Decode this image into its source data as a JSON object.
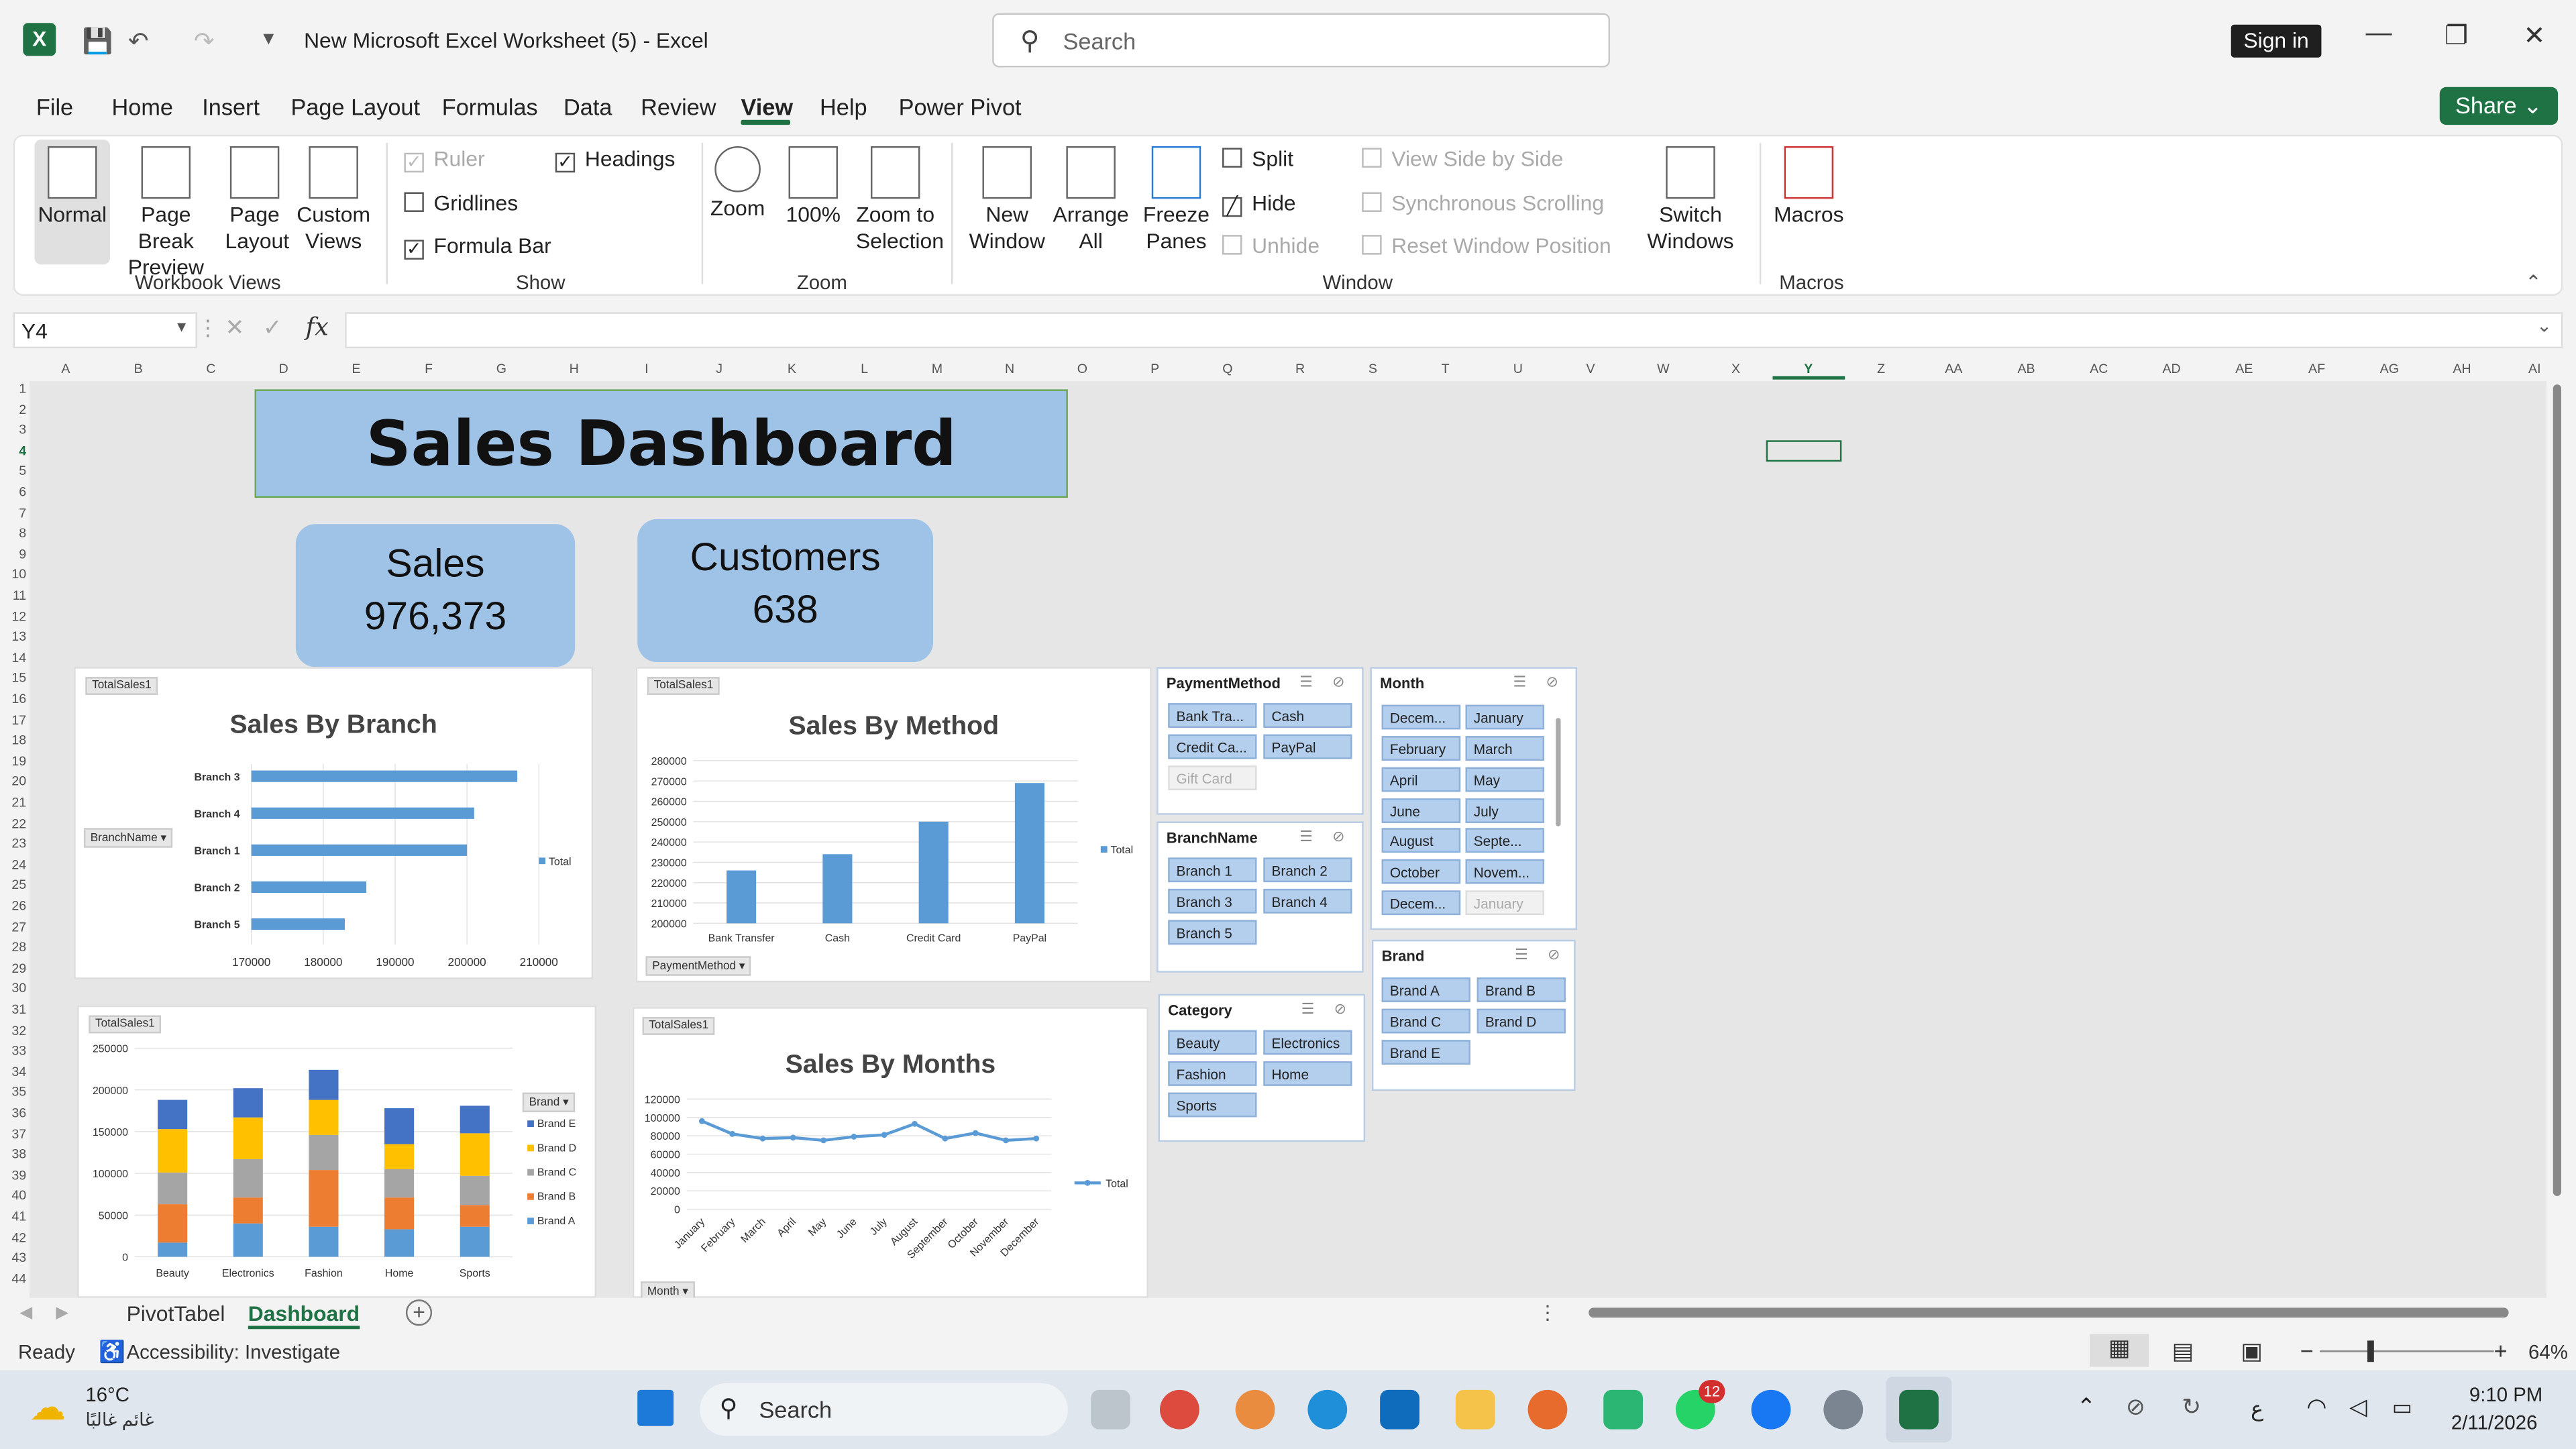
{
  "window": {
    "doc_title": "New Microsoft Excel Worksheet (5)  -  Excel",
    "search_placeholder": "Search",
    "sign_in": "Sign in",
    "share": "Share"
  },
  "tabs": [
    "File",
    "Home",
    "Insert",
    "Page Layout",
    "Formulas",
    "Data",
    "Review",
    "View",
    "Help",
    "Power Pivot"
  ],
  "ribbon": {
    "workbook_views": {
      "normal": "Normal",
      "page_break": "Page Break Preview",
      "page_layout": "Page Layout",
      "custom_views": "Custom Views",
      "group": "Workbook Views"
    },
    "show": {
      "ruler": "Ruler",
      "gridlines": "Gridlines",
      "formula_bar": "Formula Bar",
      "headings": "Headings",
      "group": "Show"
    },
    "zoom": {
      "zoom": "Zoom",
      "hundred": "100%",
      "zoom_sel": "Zoom to Selection",
      "group": "Zoom"
    },
    "window": {
      "new_window": "New Window",
      "arrange_all": "Arrange All",
      "freeze": "Freeze Panes",
      "split": "Split",
      "hide": "Hide",
      "unhide": "Unhide",
      "side_by_side": "View Side by Side",
      "sync_scroll": "Synchronous Scrolling",
      "reset_pos": "Reset Window Position",
      "switch": "Switch Windows",
      "group": "Window"
    },
    "macros": {
      "macros": "Macros",
      "group": "Macros"
    }
  },
  "formula": {
    "name_box": "Y4",
    "fx": "fx",
    "content": ""
  },
  "columns": [
    "A",
    "B",
    "C",
    "D",
    "E",
    "F",
    "G",
    "H",
    "I",
    "J",
    "K",
    "L",
    "M",
    "N",
    "O",
    "P",
    "Q",
    "R",
    "S",
    "T",
    "U",
    "V",
    "W",
    "X",
    "Y",
    "Z",
    "AA",
    "AB",
    "AC",
    "AD",
    "AE",
    "AF",
    "AG",
    "AH",
    "AI"
  ],
  "dashboard": {
    "title": "Sales Dashboard",
    "sales_label": "Sales",
    "sales_value": "976,373",
    "customers_label": "Customers",
    "customers_value": "638"
  },
  "chart_data": [
    {
      "type": "bar",
      "orientation": "horizontal",
      "title": "Sales By Branch",
      "field_button": "TotalSales1",
      "axis_button": "BranchName",
      "categories": [
        "Branch 3",
        "Branch 4",
        "Branch 1",
        "Branch 2",
        "Branch 5"
      ],
      "values": [
        207000,
        201000,
        200000,
        186000,
        183000
      ],
      "xlim": [
        170000,
        210000
      ],
      "xticks": [
        "170000",
        "180000",
        "190000",
        "200000",
        "210000"
      ],
      "legend": [
        "Total"
      ]
    },
    {
      "type": "bar",
      "title": "Sales By Method",
      "field_button": "TotalSales1",
      "axis_button": "PaymentMethod",
      "categories": [
        "Bank Transfer",
        "Cash",
        "Credit Card",
        "PayPal"
      ],
      "values": [
        226000,
        234000,
        250000,
        269000
      ],
      "ylim": [
        200000,
        280000
      ],
      "yticks": [
        "200000",
        "210000",
        "220000",
        "230000",
        "240000",
        "250000",
        "260000",
        "270000",
        "280000"
      ],
      "legend": [
        "Total"
      ]
    },
    {
      "type": "bar",
      "stacked": true,
      "field_button": "TotalSales1",
      "legend_button": "Brand",
      "categories": [
        "Beauty",
        "Electronics",
        "Fashion",
        "Home",
        "Sports"
      ],
      "series": [
        {
          "name": "Brand A",
          "color": "#5b9bd5",
          "values": [
            17000,
            40000,
            36000,
            33000,
            36000
          ]
        },
        {
          "name": "Brand B",
          "color": "#ed7d31",
          "values": [
            46000,
            31000,
            68000,
            38000,
            26000
          ]
        },
        {
          "name": "Brand C",
          "color": "#a5a5a5",
          "values": [
            38000,
            46000,
            42000,
            34000,
            35000
          ]
        },
        {
          "name": "Brand D",
          "color": "#ffc000",
          "values": [
            52000,
            50000,
            42000,
            30000,
            51000
          ]
        },
        {
          "name": "Brand E",
          "color": "#4472c4",
          "values": [
            35000,
            35000,
            36000,
            43000,
            33000
          ]
        }
      ],
      "ylim": [
        0,
        250000
      ],
      "yticks": [
        "0",
        "50000",
        "100000",
        "150000",
        "200000",
        "250000"
      ]
    },
    {
      "type": "line",
      "title": "Sales By Months",
      "field_button": "TotalSales1",
      "axis_button": "Month",
      "categories": [
        "January",
        "February",
        "March",
        "April",
        "May",
        "June",
        "July",
        "August",
        "September",
        "October",
        "November",
        "December"
      ],
      "values": [
        96000,
        82000,
        77000,
        78000,
        75000,
        79000,
        81000,
        93000,
        77000,
        83000,
        75000,
        77000
      ],
      "ylim": [
        0,
        120000
      ],
      "yticks": [
        "0",
        "20000",
        "40000",
        "60000",
        "80000",
        "100000",
        "120000"
      ],
      "legend": [
        "Total"
      ]
    }
  ],
  "slicers": {
    "payment": {
      "title": "PaymentMethod",
      "items": [
        "Bank Tra...",
        "Cash",
        "Credit Ca...",
        "PayPal",
        "Gift Card"
      ]
    },
    "month": {
      "title": "Month",
      "items": [
        "Decem...",
        "January",
        "February",
        "March",
        "April",
        "May",
        "June",
        "July",
        "August",
        "Septe...",
        "October",
        "Novem...",
        "Decem...",
        "January"
      ]
    },
    "branch": {
      "title": "BranchName",
      "items": [
        "Branch 1",
        "Branch 2",
        "Branch 3",
        "Branch 4",
        "Branch 5"
      ]
    },
    "brand": {
      "title": "Brand",
      "items": [
        "Brand A",
        "Brand B",
        "Brand C",
        "Brand D",
        "Brand E"
      ]
    },
    "category": {
      "title": "Category",
      "items": [
        "Beauty",
        "Electronics",
        "Fashion",
        "Home",
        "Sports"
      ]
    }
  },
  "sheet_tabs": [
    "PivotTabel",
    "Dashboard"
  ],
  "status": {
    "ready": "Ready",
    "accessibility": "Accessibility: Investigate",
    "zoom": "64%"
  },
  "taskbar": {
    "temp": "16°C",
    "weather": "غائم غالبًا",
    "search": "Search",
    "time": "9:10 PM",
    "date": "2/11/2026",
    "badge": "12",
    "lang": "ع"
  }
}
